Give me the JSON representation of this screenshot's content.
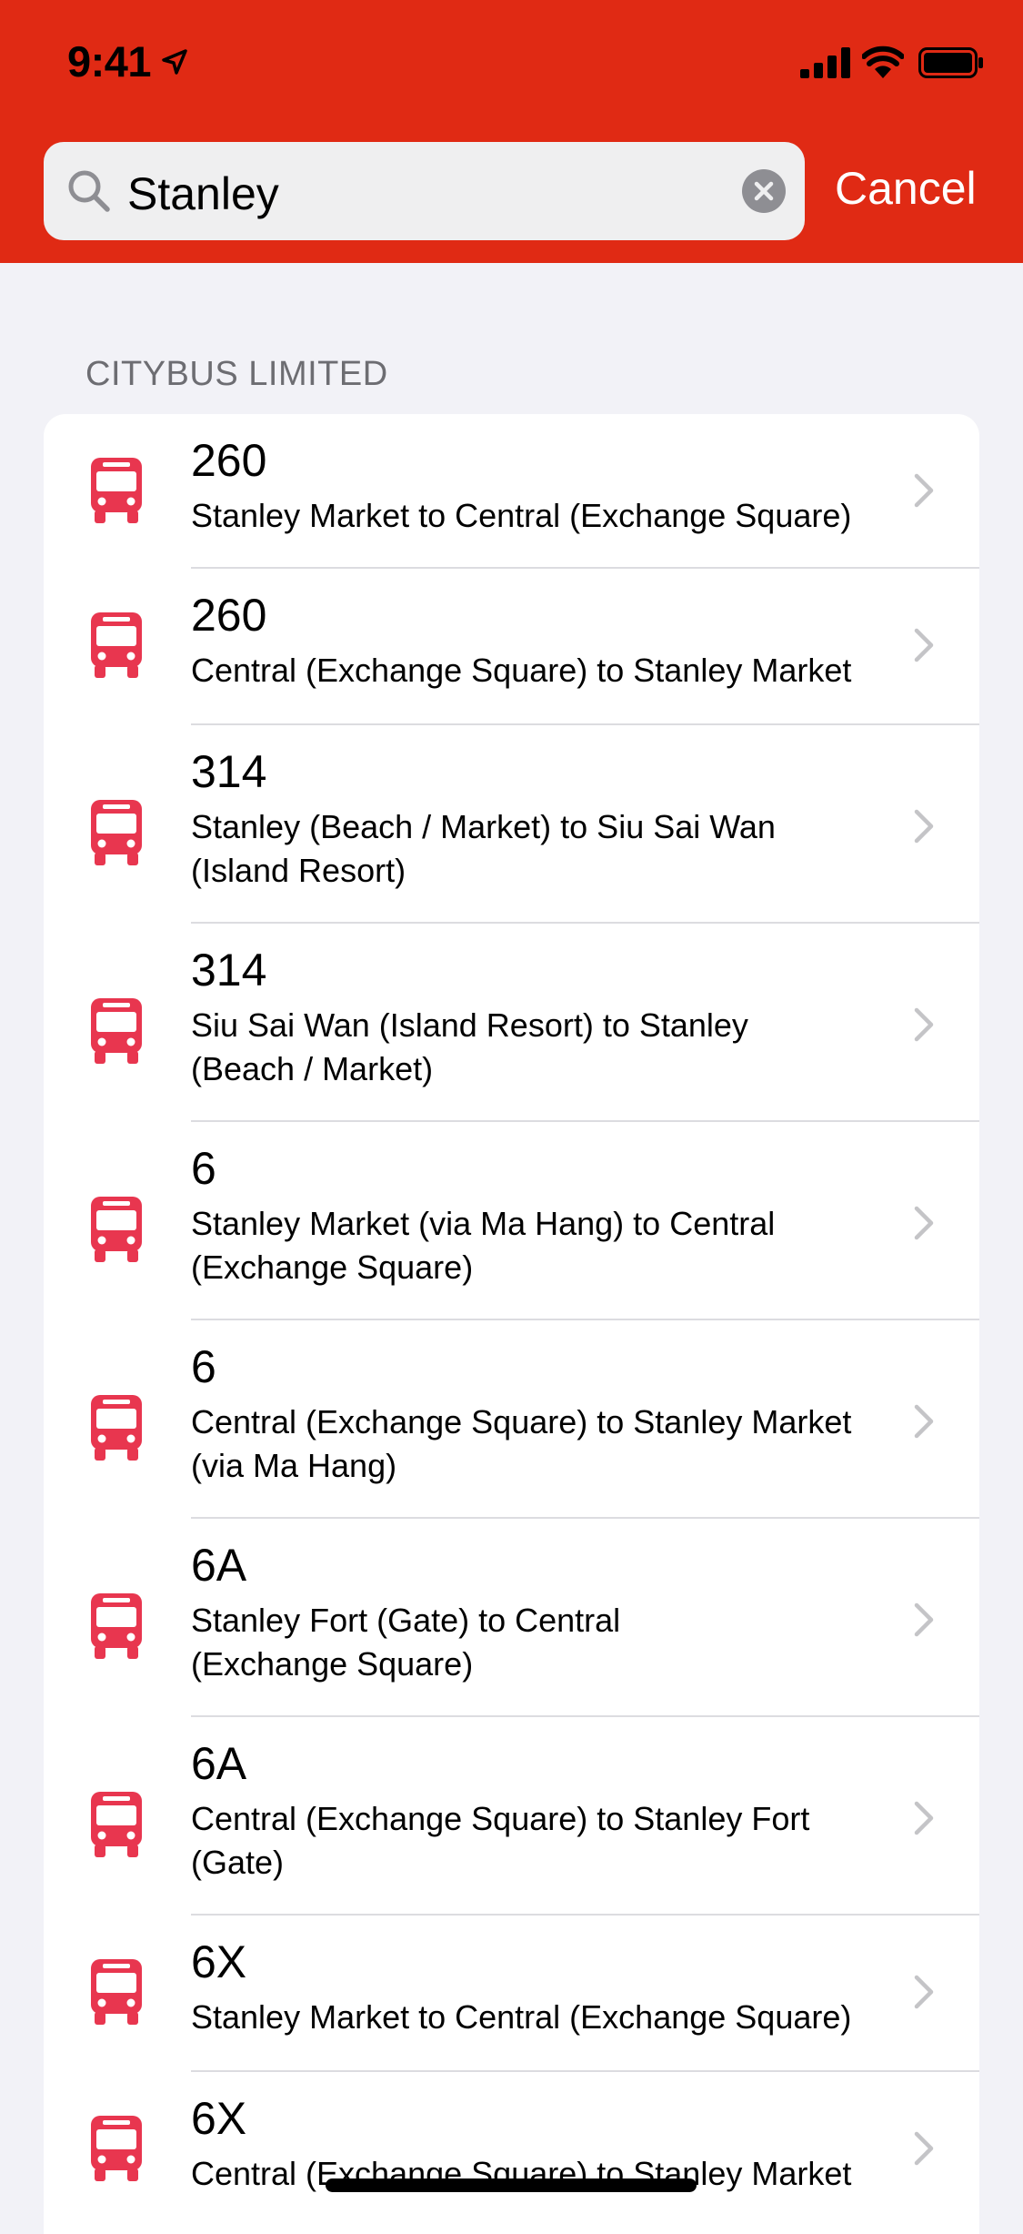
{
  "status_bar": {
    "time": "9:41"
  },
  "search": {
    "query": "Stanley",
    "cancel_label": "Cancel"
  },
  "section": {
    "title": "CITYBUS LIMITED"
  },
  "routes": [
    {
      "number": "260",
      "description": "Stanley Market to Central (Exchange Square)"
    },
    {
      "number": "260",
      "description": "Central (Exchange Square) to Stanley Market"
    },
    {
      "number": "314",
      "description": "Stanley (Beach / Market) to Siu Sai Wan (Island Resort)"
    },
    {
      "number": "314",
      "description": "Siu Sai Wan (Island Resort) to Stanley (Beach / Market)"
    },
    {
      "number": "6",
      "description": "Stanley Market (via Ma Hang) to Central (Exchange Square)"
    },
    {
      "number": "6",
      "description": "Central (Exchange Square) to Stanley Market (via Ma Hang)"
    },
    {
      "number": "6A",
      "description": "Stanley Fort (Gate) to Central (Exchange Square)"
    },
    {
      "number": "6A",
      "description": "Central (Exchange Square) to Stanley Fort (Gate)"
    },
    {
      "number": "6X",
      "description": "Stanley Market to Central (Exchange Square)"
    },
    {
      "number": "6X",
      "description": "Central (Exchange Square) to Stanley Market"
    }
  ],
  "colors": {
    "header": "#e02a14",
    "bus_icon": "#e8364f",
    "background": "#f2f2f7"
  },
  "icons": {
    "route_icon": "bus-icon",
    "row_accessory": "chevron-right-icon",
    "search": "magnifying-glass-icon",
    "clear": "clear-circle-icon"
  }
}
